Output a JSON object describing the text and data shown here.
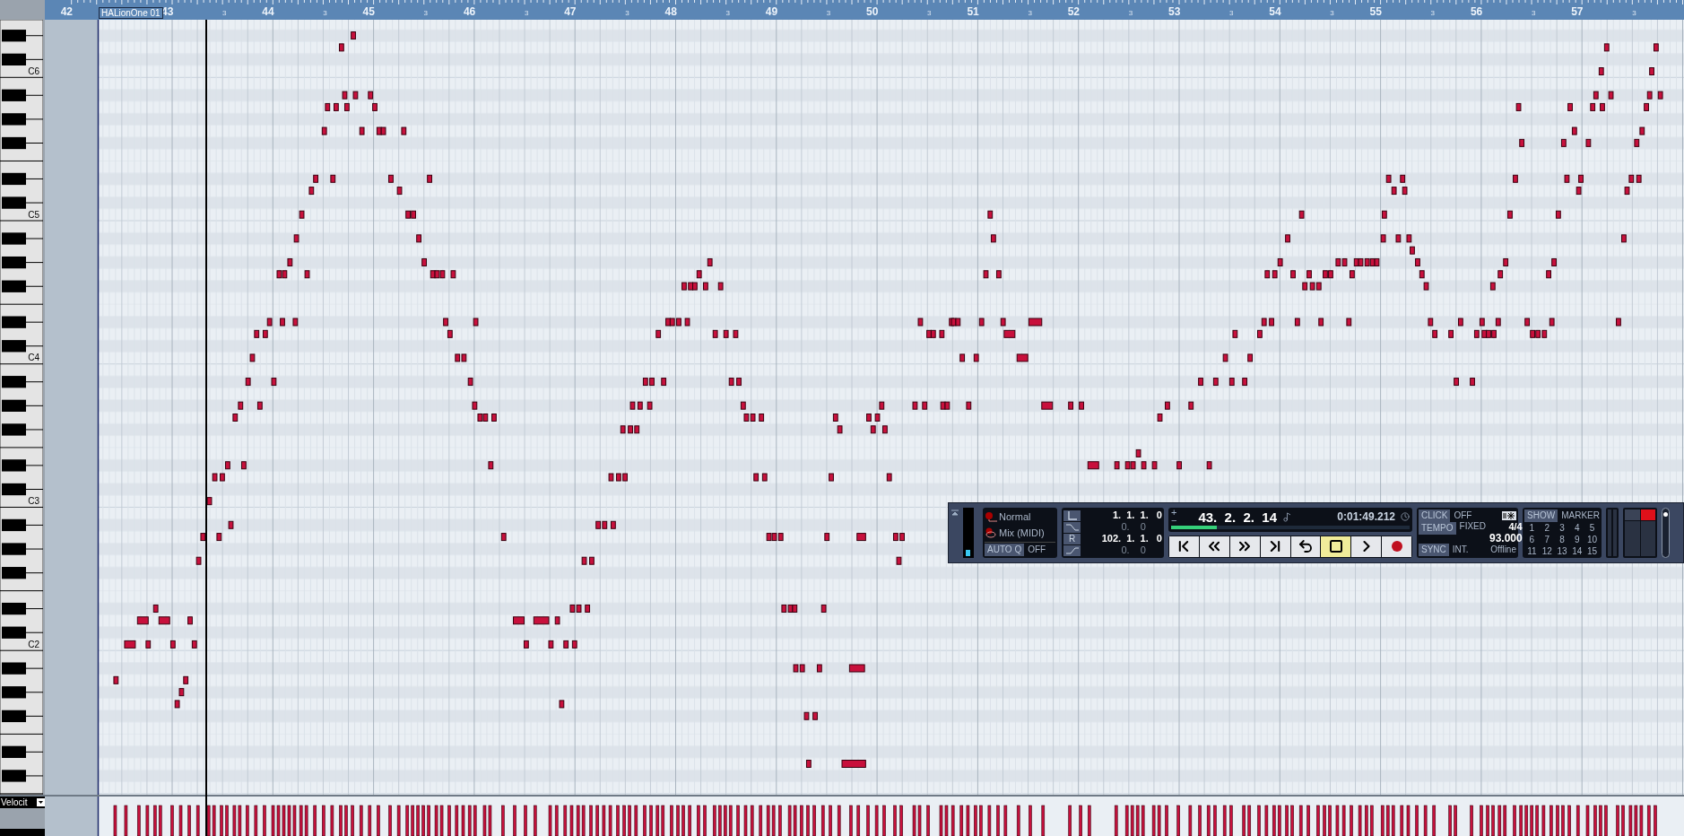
{
  "ruler": {
    "bars": [
      {
        "label": "42"
      },
      {
        "label": "43",
        "sub_label": "3"
      },
      {
        "label": "44",
        "sub_label": "3"
      },
      {
        "label": "45",
        "sub_label": "3"
      },
      {
        "label": "46",
        "sub_label": "3"
      },
      {
        "label": "47",
        "sub_label": "3"
      },
      {
        "label": "48",
        "sub_label": "3"
      },
      {
        "label": "49",
        "sub_label": "3"
      },
      {
        "label": "50",
        "sub_label": "3"
      },
      {
        "label": "51",
        "sub_label": "3"
      },
      {
        "label": "52",
        "sub_label": "3"
      },
      {
        "label": "53",
        "sub_label": "3"
      },
      {
        "label": "54",
        "sub_label": "3"
      },
      {
        "label": "55",
        "sub_label": "3"
      },
      {
        "label": "56",
        "sub_label": "3"
      },
      {
        "label": "57",
        "sub_label": "3"
      }
    ]
  },
  "part_label": "HALionOne 01",
  "keyboard": {
    "octave_labels": [
      "C6",
      "C5",
      "C4",
      "C3",
      "C2"
    ]
  },
  "controller_lane": {
    "selector": "Velocit"
  },
  "transport": {
    "meter": {
      "level": 0.12
    },
    "record_mode": "Normal",
    "cycle_mode": "Mix (MIDI)",
    "auto_q": {
      "label": "AUTO Q",
      "value": "OFF"
    },
    "locators": [
      {
        "kind": "left",
        "value": "1.  1.  1.   0"
      },
      {
        "kind": "pre",
        "value": "0.    0"
      },
      {
        "kind": "right",
        "label": "R",
        "value": "102.  1.  1.   0"
      },
      {
        "kind": "post",
        "value": "0.    0"
      }
    ],
    "nudge": {
      "plus": "+",
      "minus": "−"
    },
    "position": "43.  2.  2.  14",
    "time": "0:01:49.212",
    "progress": {
      "level": 0.19
    },
    "buttons": [
      {
        "kind": "start",
        "selected": false
      },
      {
        "kind": "rewind",
        "selected": false
      },
      {
        "kind": "forward",
        "selected": false
      },
      {
        "kind": "end",
        "selected": false
      },
      {
        "kind": "cycle",
        "selected": false
      },
      {
        "kind": "stop",
        "selected": true
      },
      {
        "kind": "play",
        "selected": false
      },
      {
        "kind": "record",
        "selected": false
      }
    ],
    "click": {
      "label": "CLICK",
      "value": "OFF"
    },
    "tempo": {
      "label": "TEMPO",
      "mode": "FIXED",
      "signature": "4/4",
      "bpm": "93.000"
    },
    "sync": {
      "label": "SYNC",
      "mode": "INT.",
      "status": "Offline"
    },
    "markers": {
      "show": "SHOW",
      "title": "MARKER",
      "numbers": [
        "1",
        "2",
        "3",
        "4",
        "5",
        "6",
        "7",
        "8",
        "9",
        "10",
        "11",
        "12",
        "13",
        "14",
        "15"
      ]
    }
  }
}
